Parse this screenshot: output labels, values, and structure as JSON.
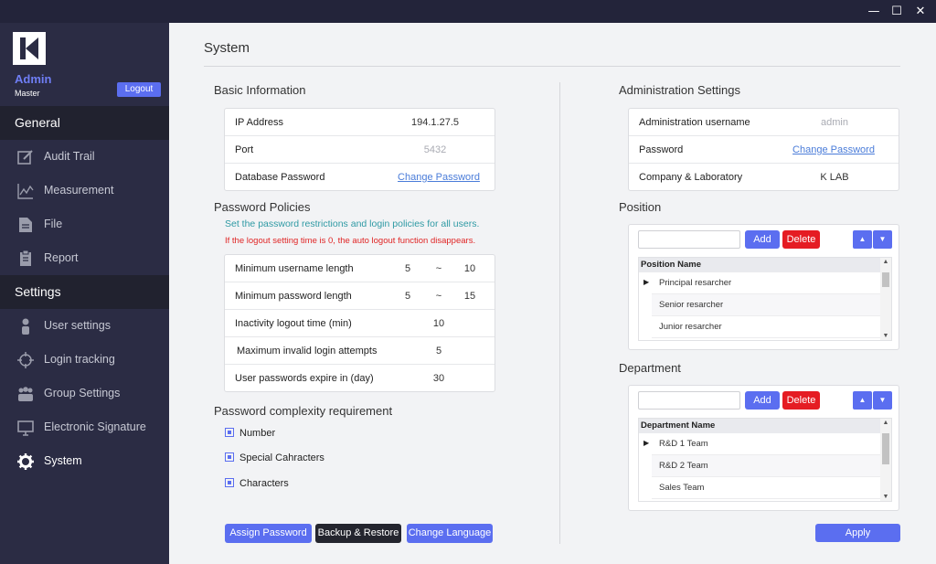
{
  "window": {
    "minimize": "—",
    "maximize": "☐",
    "close": "✕"
  },
  "sidebar": {
    "user_name": "Admin",
    "user_role": "Master",
    "logout_label": "Logout",
    "general_heading": "General",
    "general_items": [
      {
        "label": "Audit Trail",
        "icon": "edit-icon"
      },
      {
        "label": "Measurement",
        "icon": "chart-icon"
      },
      {
        "label": "File",
        "icon": "file-icon"
      },
      {
        "label": "Report",
        "icon": "report-icon"
      }
    ],
    "settings_heading": "Settings",
    "settings_items": [
      {
        "label": "User settings",
        "icon": "user-icon"
      },
      {
        "label": "Login tracking",
        "icon": "target-icon"
      },
      {
        "label": "Group Settings",
        "icon": "group-icon"
      },
      {
        "label": "Electronic Signature",
        "icon": "monitor-icon"
      },
      {
        "label": "System",
        "icon": "gear-icon"
      }
    ]
  },
  "page": {
    "title": "System",
    "basic_info": {
      "title": "Basic Information",
      "rows": [
        {
          "label": "IP Address",
          "value": "194.1.27.5"
        },
        {
          "label": "Port",
          "value": "5432"
        },
        {
          "label": "Database Password",
          "value": "Change Password"
        }
      ]
    },
    "password_policies": {
      "title": "Password Policies",
      "note_teal": "Set the password restrictions and login policies for all users.",
      "note_red": "If the logout setting time is 0, the auto logout function disappears.",
      "rows": [
        {
          "label": "Minimum username length",
          "min": "5",
          "sep": "~",
          "max": "10"
        },
        {
          "label": "Minimum password length",
          "min": "5",
          "sep": "~",
          "max": "15"
        },
        {
          "label": "Inactivity logout time (min)",
          "value": "10"
        },
        {
          "label": "Maximum invalid login attempts",
          "value": "5"
        },
        {
          "label": "User passwords expire in (day)",
          "value": "30"
        }
      ]
    },
    "complexity": {
      "title": "Password complexity requirement",
      "items": [
        "Number",
        "Special Cahracters",
        "Characters"
      ]
    },
    "buttons": {
      "assign_password": "Assign Password",
      "backup_restore": "Backup & Restore",
      "change_language": "Change Language",
      "apply": "Apply"
    },
    "admin_settings": {
      "title": "Administration Settings",
      "rows": [
        {
          "label": "Administration username",
          "value": "admin"
        },
        {
          "label": "Password",
          "value": "Change Password"
        },
        {
          "label": "Company & Laboratory",
          "value": "K LAB"
        }
      ]
    },
    "position": {
      "title": "Position",
      "add_label": "Add",
      "delete_label": "Delete",
      "up_label": "▲",
      "down_label": "▼",
      "column": "Position Name",
      "rows": [
        "Principal resarcher",
        "Senior resarcher",
        "Junior resarcher"
      ]
    },
    "department": {
      "title": "Department",
      "add_label": "Add",
      "delete_label": "Delete",
      "up_label": "▲",
      "down_label": "▼",
      "column": "Department Name",
      "rows": [
        "R&D 1 Team",
        "R&D 2 Team",
        "Sales Team"
      ]
    }
  },
  "colors": {
    "accent": "#5b6ef0",
    "sidebar_bg": "#2b2c44",
    "danger": "#e51c23",
    "teal_note": "#2f9aa4"
  }
}
